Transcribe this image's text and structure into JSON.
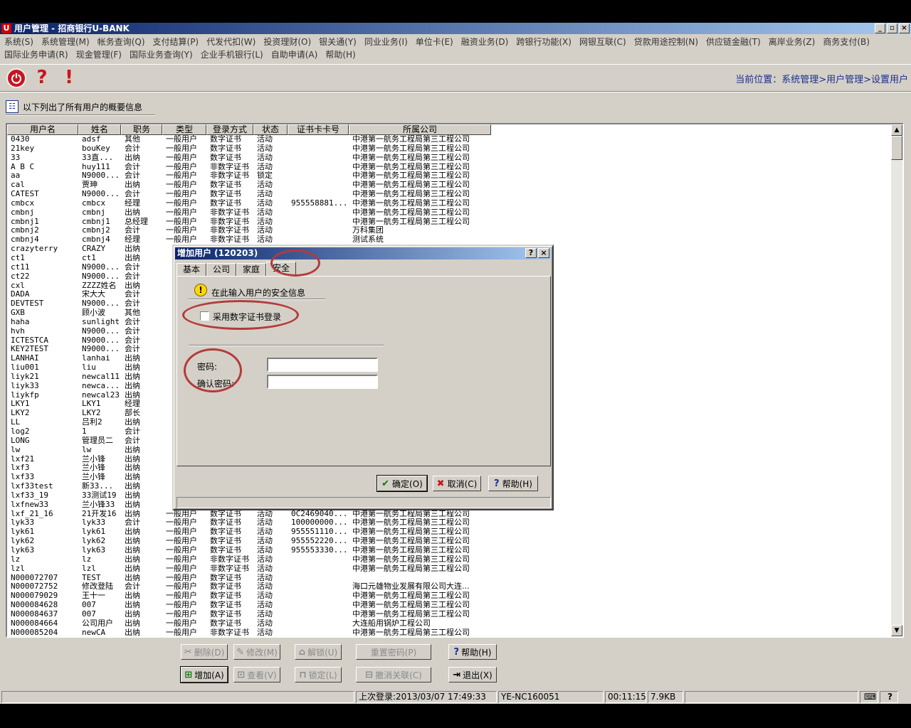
{
  "window": {
    "title": "用户管理 - 招商银行U-BANK",
    "minimize": "_",
    "maximize": "▫",
    "close": "×"
  },
  "menu_row1": [
    "系统(S)",
    "系统管理(M)",
    "帐务查询(Q)",
    "支付结算(P)",
    "代发代扣(W)",
    "投资理财(O)",
    "银关通(Y)",
    "同业业务(I)",
    "单位卡(E)",
    "融资业务(D)",
    "跨银行功能(X)",
    "网银互联(C)",
    "贷款用途控制(N)",
    "供应链金融(T)",
    "离岸业务(Z)",
    "商务支付(B)"
  ],
  "menu_row2": [
    "国际业务申请(R)",
    "现金管理(F)",
    "国际业务查询(Y)",
    "企业手机银行(L)",
    "自助申请(A)",
    "帮助(H)"
  ],
  "toolbar": {
    "power": "⏻",
    "help": "?",
    "warn": "!"
  },
  "location": "当前位置：系统管理>用户管理>设置用户",
  "summary_label": "以下列出了所有用户的概要信息",
  "table": {
    "headers": [
      "用户名",
      "姓名",
      "职务",
      "类型",
      "登录方式",
      "状态",
      "证书卡卡号",
      "所属公司"
    ],
    "rows": [
      [
        "0430",
        "adsf",
        "其他",
        "一般用户",
        "数字证书",
        "活动",
        "",
        "中港第一航务工程局第三工程公司"
      ],
      [
        "21key",
        "bouKey",
        "会计",
        "一般用户",
        "数字证书",
        "活动",
        "",
        "中港第一航务工程局第三工程公司"
      ],
      [
        "33",
        "33直...",
        "出纳",
        "一般用户",
        "数字证书",
        "活动",
        "",
        "中港第一航务工程局第三工程公司"
      ],
      [
        "A B C",
        "huy111",
        "会计",
        "一般用户",
        "非数字证书",
        "活动",
        "",
        "中港第一航务工程局第三工程公司"
      ],
      [
        "aa",
        "N9000...",
        "会计",
        "一般用户",
        "非数字证书",
        "锁定",
        "",
        "中港第一航务工程局第三工程公司"
      ],
      [
        "cal",
        "贾珅",
        "出纳",
        "一般用户",
        "数字证书",
        "活动",
        "",
        "中港第一航务工程局第三工程公司"
      ],
      [
        "CATEST",
        "N9000...",
        "会计",
        "一般用户",
        "数字证书",
        "活动",
        "",
        "中港第一航务工程局第三工程公司"
      ],
      [
        "cmbcx",
        "cmbcx",
        "经理",
        "一般用户",
        "数字证书",
        "活动",
        "955558881...",
        "中港第一航务工程局第三工程公司"
      ],
      [
        "cmbnj",
        "cmbnj",
        "出纳",
        "一般用户",
        "非数字证书",
        "活动",
        "",
        "中港第一航务工程局第三工程公司"
      ],
      [
        "cmbnj1",
        "cmbnj1",
        "总经理",
        "一般用户",
        "非数字证书",
        "活动",
        "",
        "中港第一航务工程局第三工程公司"
      ],
      [
        "cmbnj2",
        "cmbnj2",
        "会计",
        "一般用户",
        "非数字证书",
        "活动",
        "",
        "万科集团"
      ],
      [
        "cmbnj4",
        "cmbnj4",
        "经理",
        "一般用户",
        "非数字证书",
        "活动",
        "",
        "测试系统"
      ],
      [
        "crazyterry",
        "CRAZY",
        "出纳",
        "",
        "",
        "",
        "",
        ""
      ],
      [
        "ct1",
        "ct1",
        "出纳",
        "",
        "",
        "",
        "",
        ""
      ],
      [
        "ct11",
        "N9000...",
        "会计",
        "",
        "",
        "",
        "",
        ""
      ],
      [
        "ct22",
        "N9000...",
        "会计",
        "",
        "",
        "",
        "",
        ""
      ],
      [
        "cxl",
        "ZZZZ姓名",
        "出纳",
        "",
        "",
        "",
        "",
        ""
      ],
      [
        "DADA",
        "宋大大",
        "会计",
        "",
        "",
        "",
        "",
        ""
      ],
      [
        "DEVTEST",
        "N9000...",
        "会计",
        "",
        "",
        "",
        "",
        ""
      ],
      [
        "GXB",
        "顾小波",
        "其他",
        "",
        "",
        "",
        "",
        ""
      ],
      [
        "haha",
        "sunlight",
        "会计",
        "",
        "",
        "",
        "",
        ""
      ],
      [
        "hvh",
        "N9000...",
        "会计",
        "",
        "",
        "",
        "",
        ""
      ],
      [
        "ICTESTCA",
        "N9000...",
        "会计",
        "",
        "",
        "",
        "",
        ""
      ],
      [
        "KEY2TEST",
        "N9000...",
        "会计",
        "",
        "",
        "",
        "",
        ""
      ],
      [
        "LANHAI",
        "lanhai",
        "出纳",
        "",
        "",
        "",
        "",
        ""
      ],
      [
        "liu001",
        "liu",
        "出纳",
        "",
        "",
        "",
        "",
        ""
      ],
      [
        "liyk21",
        "newcal11",
        "出纳",
        "",
        "",
        "",
        "",
        ""
      ],
      [
        "liyk33",
        "newca...",
        "出纳",
        "",
        "",
        "",
        "",
        ""
      ],
      [
        "liykfp",
        "newcal23",
        "出纳",
        "",
        "",
        "",
        "",
        ""
      ],
      [
        "LKY1",
        "LKY1",
        "经理",
        "",
        "",
        "",
        "",
        ""
      ],
      [
        "LKY2",
        "LKY2",
        "部长",
        "",
        "",
        "",
        "",
        ""
      ],
      [
        "LL",
        "吕利2",
        "出纳",
        "",
        "",
        "",
        "",
        ""
      ],
      [
        "log2",
        "1",
        "会计",
        "",
        "",
        "",
        "",
        ""
      ],
      [
        "LONG",
        "管理员二",
        "会计",
        "",
        "",
        "",
        "",
        ""
      ],
      [
        "lw",
        "lw",
        "出纳",
        "",
        "",
        "",
        "",
        ""
      ],
      [
        "lxf21",
        "兰小锋",
        "出纳",
        "",
        "",
        "",
        "",
        ""
      ],
      [
        "lxf3",
        "兰小锋",
        "出纳",
        "",
        "",
        "",
        "",
        ""
      ],
      [
        "lxf33",
        "兰小锋",
        "出纳",
        "",
        "",
        "",
        "",
        ""
      ],
      [
        "lxf33test",
        "新33...",
        "出纳",
        "",
        "",
        "",
        "",
        ""
      ],
      [
        "lxf33_19",
        "33测试19",
        "出纳",
        "",
        "",
        "",
        "",
        ""
      ],
      [
        "lxfnew33",
        "兰小锋33",
        "出纳",
        "",
        "",
        "",
        "",
        ""
      ],
      [
        "lxf_21_16",
        "21开发16",
        "出纳",
        "一般用户",
        "数字证书",
        "活动",
        "0C2469040...",
        "中港第一航务工程局第三工程公司"
      ],
      [
        "lyk33",
        "lyk33",
        "会计",
        "一般用户",
        "数字证书",
        "活动",
        "100000000...",
        "中港第一航务工程局第三工程公司"
      ],
      [
        "lyk61",
        "lyk61",
        "出纳",
        "一般用户",
        "数字证书",
        "活动",
        "955551110...",
        "中港第一航务工程局第三工程公司"
      ],
      [
        "lyk62",
        "lyk62",
        "出纳",
        "一般用户",
        "数字证书",
        "活动",
        "955552220...",
        "中港第一航务工程局第三工程公司"
      ],
      [
        "lyk63",
        "lyk63",
        "出纳",
        "一般用户",
        "数字证书",
        "活动",
        "955553330...",
        "中港第一航务工程局第三工程公司"
      ],
      [
        "lz",
        "lz",
        "出纳",
        "一般用户",
        "非数字证书",
        "活动",
        "",
        "中港第一航务工程局第三工程公司"
      ],
      [
        "lzl",
        "lzl",
        "出纳",
        "一般用户",
        "非数字证书",
        "活动",
        "",
        "中港第一航务工程局第三工程公司"
      ],
      [
        "N000072707",
        "TEST",
        "出纳",
        "一般用户",
        "数字证书",
        "活动",
        "",
        ""
      ],
      [
        "N000072752",
        "修改登陆",
        "会计",
        "一般用户",
        "数字证书",
        "活动",
        "",
        "海口元雄物业发展有限公司大连..."
      ],
      [
        "N000079029",
        "王十一",
        "出纳",
        "一般用户",
        "数字证书",
        "活动",
        "",
        "中港第一航务工程局第三工程公司"
      ],
      [
        "N000084628",
        "007",
        "出纳",
        "一般用户",
        "数字证书",
        "活动",
        "",
        "中港第一航务工程局第三工程公司"
      ],
      [
        "N000084637",
        "007",
        "出纳",
        "一般用户",
        "数字证书",
        "活动",
        "",
        "中港第一航务工程局第三工程公司"
      ],
      [
        "N000084664",
        "公司用户",
        "出纳",
        "一般用户",
        "数字证书",
        "活动",
        "",
        "大连船用锅炉工程公司"
      ],
      [
        "N000085204",
        "newCA",
        "出纳",
        "一般用户",
        "非数字证书",
        "活动",
        "",
        "中港第一航务工程局第三工程公司"
      ]
    ]
  },
  "buttons": {
    "delete": "删除(D)",
    "modify": "修改(M)",
    "unlock": "解锁(U)",
    "reset_password": "重置密码(P)",
    "help": "帮助(H)",
    "add": "增加(A)",
    "view": "查看(V)",
    "lock": "锁定(L)",
    "unlink": "撤消关联(C)",
    "exit": "退出(X)"
  },
  "statusbar": {
    "last_login": "上次登录:2013/03/07 17:49:33",
    "host": "YE-NC160051",
    "elapsed": "00:11:15",
    "size": "7.9KB"
  },
  "dialog": {
    "title": "增加用户 (120203)",
    "help_btn": "?",
    "close_btn": "×",
    "tabs": [
      "基本",
      "公司",
      "家庭",
      "安全"
    ],
    "info_text": "在此输入用户的安全信息",
    "cert_checkbox_label": "采用数字证书登录",
    "password_label": "密码:",
    "confirm_label": "确认密码:",
    "password_value": "",
    "confirm_value": "",
    "ok": "确定(O)",
    "cancel": "取消(C)",
    "help": "帮助(H)"
  },
  "colors": {
    "window_bg": "#d4d0c8",
    "title_gradient_start": "#0a246a",
    "accent_red": "#c8141e",
    "annotation_red": "#b43a3a",
    "location_text": "#1a2f8a"
  }
}
